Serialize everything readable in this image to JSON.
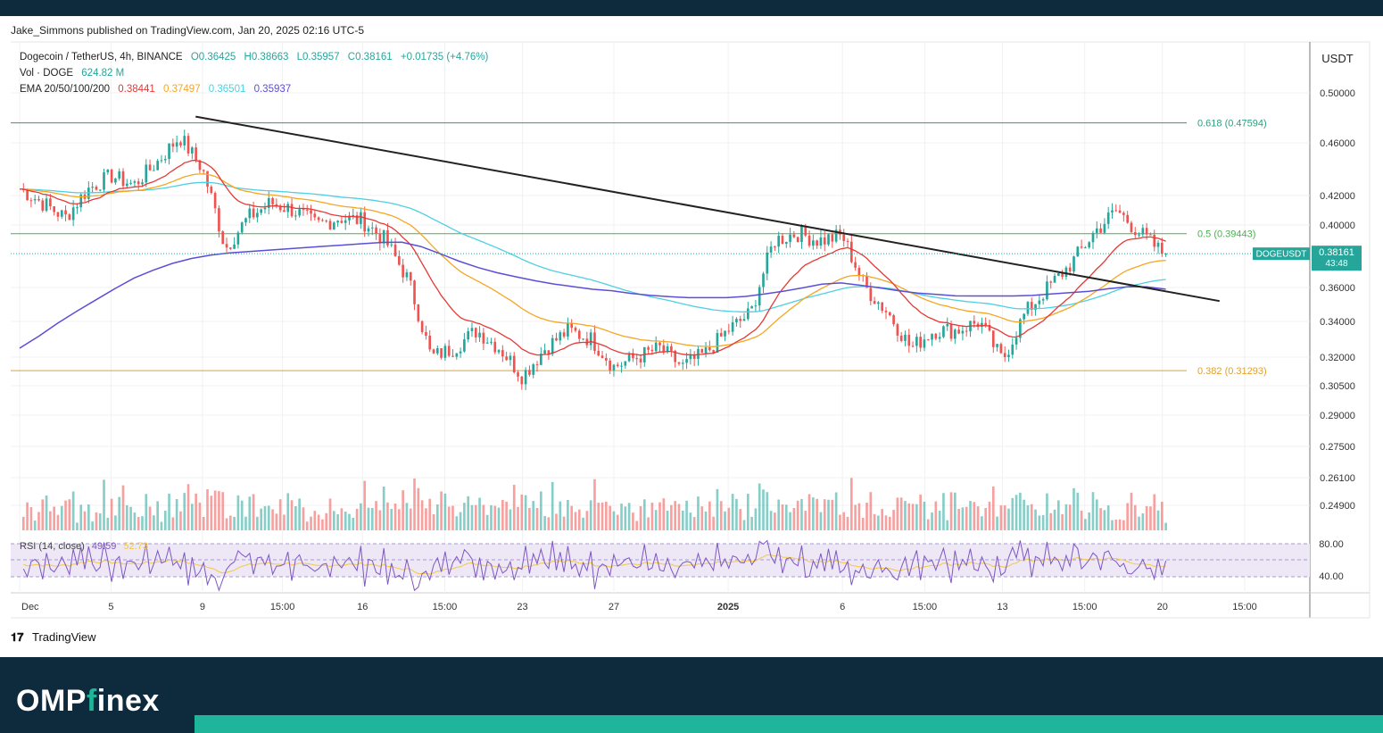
{
  "header": {
    "published": "Jake_Simmons published on TradingView.com, Jan 20, 2025 02:16 UTC-5"
  },
  "legend": {
    "symbol": "Dogecoin / TetherUS, 4h, BINANCE",
    "ohlc_o": "O0.36425",
    "ohlc_h": "H0.38663",
    "ohlc_l": "L0.35957",
    "ohlc_c": "C0.38161",
    "change": "+0.01735 (+4.76%)",
    "vol_label": "Vol · DOGE",
    "vol_value": "624.82 M",
    "ema_label": "EMA 20/50/100/200",
    "ema_values": [
      "0.38441",
      "0.37497",
      "0.36501",
      "0.35937"
    ],
    "rsi_label": "RSI (14, close)",
    "rsi_value": "49.59",
    "rsi_ma_value": "52.73"
  },
  "axis": {
    "currency": "USDT",
    "price_tag_symbol": "DOGEUSDT",
    "price_tag_value": "0.38161",
    "price_tag_countdown": "43:48"
  },
  "fib": [
    {
      "label": "0.618 (0.47594)",
      "value": 0.47594,
      "color": "#2e9c7f"
    },
    {
      "label": "0.5 (0.39443)",
      "value": 0.39443,
      "color": "#4caf50"
    },
    {
      "label": "0.382 (0.31293)",
      "value": 0.31293,
      "color": "#e0a030"
    }
  ],
  "colors": {
    "up": "#26a69a",
    "down": "#ef5350",
    "ema20": "#e53935",
    "ema50": "#f5a623",
    "ema100": "#4dd0e1",
    "ema200": "#5c4ed6",
    "rsi": "#7e57c2",
    "rsi_ma": "#f5c842",
    "trendline": "#222222"
  },
  "footer": {
    "tv_logo": "TradingView",
    "brand_main": "OMP",
    "brand_f": "f",
    "brand_rest": "inex"
  },
  "chart_data": {
    "type": "candlestick",
    "title": "Dogecoin / TetherUS, 4h, BINANCE",
    "y_ticks": [
      0.5,
      0.46,
      0.42,
      0.4,
      0.36,
      0.34,
      0.32,
      0.305,
      0.29,
      0.275,
      0.261,
      0.249
    ],
    "y_tick_labels": [
      "0.50000",
      "0.46000",
      "0.42000",
      "0.40000",
      "0.36000",
      "0.34000",
      "0.32000",
      "0.30500",
      "0.29000",
      "0.27500",
      "0.26100",
      "0.24900"
    ],
    "rsi_ticks": [
      80,
      40
    ],
    "rsi_tick_labels": [
      "80.00",
      "40.00"
    ],
    "x_ticks": [
      {
        "label": "Dec",
        "t": 0
      },
      {
        "label": "5",
        "t": 4
      },
      {
        "label": "9",
        "t": 8
      },
      {
        "label": "15:00",
        "t": 11.5
      },
      {
        "label": "16",
        "t": 15
      },
      {
        "label": "15:00",
        "t": 18.6
      },
      {
        "label": "23",
        "t": 22
      },
      {
        "label": "27",
        "t": 26
      },
      {
        "label": "2025",
        "t": 31
      },
      {
        "label": "6",
        "t": 36
      },
      {
        "label": "15:00",
        "t": 39.6
      },
      {
        "label": "13",
        "t": 43
      },
      {
        "label": "15:00",
        "t": 46.6
      },
      {
        "label": "20",
        "t": 50
      },
      {
        "label": "15:00",
        "t": 53.6
      }
    ],
    "x_days": [
      0,
      1,
      2,
      3,
      4,
      5,
      6,
      7,
      8,
      9,
      10,
      11,
      12,
      13,
      14,
      15,
      16,
      17,
      18,
      19,
      20,
      21,
      22,
      23,
      24,
      25,
      26,
      27,
      28,
      29,
      30,
      31,
      32,
      33,
      34,
      35,
      36,
      37,
      38,
      39,
      40,
      41,
      42,
      43,
      44,
      45,
      46,
      47,
      48,
      49,
      50
    ],
    "close_daily": [
      0.425,
      0.415,
      0.405,
      0.425,
      0.435,
      0.428,
      0.445,
      0.465,
      0.44,
      0.385,
      0.405,
      0.415,
      0.41,
      0.4,
      0.405,
      0.403,
      0.39,
      0.365,
      0.32,
      0.325,
      0.335,
      0.325,
      0.31,
      0.325,
      0.335,
      0.33,
      0.315,
      0.32,
      0.325,
      0.315,
      0.322,
      0.335,
      0.345,
      0.39,
      0.395,
      0.39,
      0.393,
      0.36,
      0.345,
      0.325,
      0.335,
      0.335,
      0.34,
      0.318,
      0.345,
      0.36,
      0.375,
      0.395,
      0.41,
      0.395,
      0.382
    ],
    "ema200_daily": [
      0.325,
      0.333,
      0.342,
      0.35,
      0.358,
      0.366,
      0.372,
      0.377,
      0.38,
      0.382,
      0.383,
      0.384,
      0.385,
      0.386,
      0.387,
      0.388,
      0.389,
      0.389,
      0.384,
      0.378,
      0.373,
      0.369,
      0.366,
      0.363,
      0.361,
      0.359,
      0.358,
      0.356,
      0.355,
      0.354,
      0.354,
      0.354,
      0.355,
      0.357,
      0.359,
      0.362,
      0.363,
      0.361,
      0.359,
      0.357,
      0.356,
      0.355,
      0.355,
      0.355,
      0.355,
      0.356,
      0.357,
      0.358,
      0.36,
      0.361,
      0.359
    ],
    "trendline": {
      "start": {
        "t": 7.7,
        "y": 0.481
      },
      "end": {
        "t": 52.5,
        "y": 0.352
      }
    },
    "last_price": 0.38161
  }
}
